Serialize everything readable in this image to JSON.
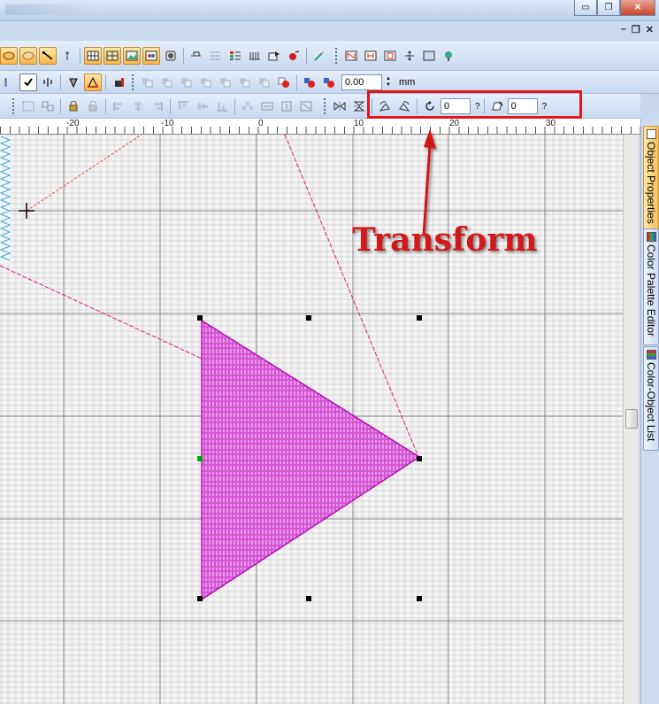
{
  "window": {
    "buttons": {
      "minimize": "▭",
      "maximize": "❐",
      "close": "✕"
    },
    "mdi_buttons": {
      "minimize": "–",
      "restore": "❐",
      "close": "✕"
    }
  },
  "toolbar_row3": {
    "offset_value": "0.00",
    "unit_label": "mm"
  },
  "transform_toolbar": {
    "rotate_value": "0",
    "rotate_help": "?",
    "skew_value": "0",
    "skew_help": "?"
  },
  "ruler": {
    "labels": [
      "-20",
      "-10",
      "0",
      "10",
      "20",
      "30"
    ]
  },
  "side_tabs": [
    {
      "label": "Object Properties",
      "active": true
    },
    {
      "label": "Color Palette Editor",
      "active": false
    },
    {
      "label": "Color-Object List",
      "active": false
    }
  ],
  "annotation": {
    "text": "Transform",
    "color": "#d21818"
  },
  "colors": {
    "selected_object": "#cc22cc",
    "guide_line": "#e0187a",
    "highlight_frame": "#e01818"
  }
}
